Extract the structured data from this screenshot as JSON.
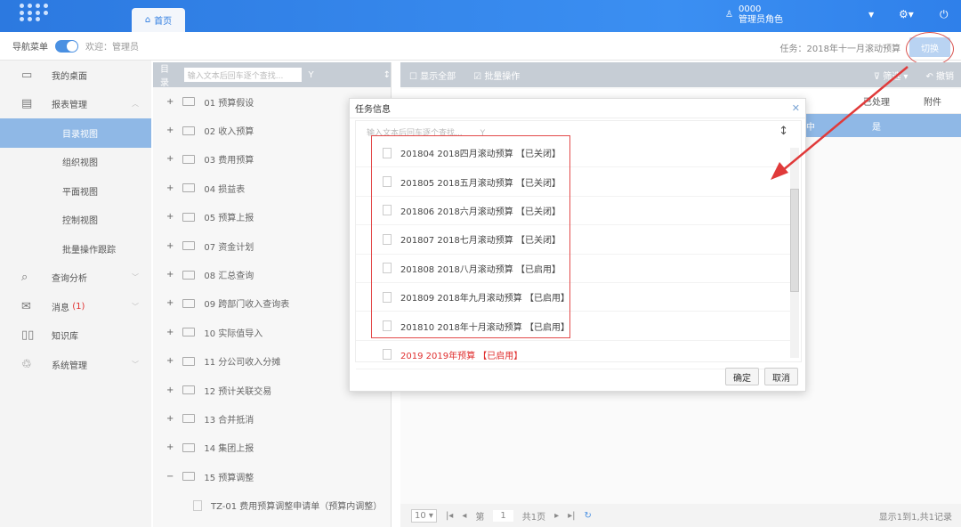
{
  "header": {
    "home_tab": "首页",
    "user_id": "0000",
    "user_role": "管理员角色"
  },
  "subbar": {
    "nav_label": "导航菜单",
    "welcome": "欢迎：管理员",
    "task": "任务：2018年十一月滚动预算",
    "switch": "切换"
  },
  "sidebar": {
    "items": [
      {
        "label": "我的桌面",
        "icon": "monitor-icon"
      },
      {
        "label": "报表管理",
        "icon": "report-icon"
      }
    ],
    "subitems": [
      "目录视图",
      "组织视图",
      "平面视图",
      "控制视图",
      "批量操作跟踪"
    ],
    "bottom": [
      {
        "label": "查询分析"
      },
      {
        "label": "消息",
        "badge": "(1)"
      },
      {
        "label": "知识库"
      },
      {
        "label": "系统管理"
      }
    ]
  },
  "tree": {
    "title": "目录",
    "placeholder": "输入文本后回车逐个查找...",
    "items": [
      "01 预算假设",
      "02 收入预算",
      "03 费用预算",
      "04 损益表",
      "05 预算上报",
      "07 资金计划",
      "08 汇总查询",
      "09 跨部门收入查询表",
      "10 实际值导入",
      "11 分公司收入分摊",
      "12 预计关联交易",
      "13 合并抵消",
      "14 集团上报",
      "15 预算调整"
    ],
    "leaf": "TZ-01 费用预算调整申请单（预算内调整）"
  },
  "main": {
    "show_all": "显示全部",
    "batch": "批量操作",
    "filter": "筛选",
    "undo": "撤销",
    "col_processed": "已处理",
    "col_attach": "附件",
    "row_status": "中",
    "row_processed": "是",
    "pager": {
      "size": "10",
      "page_prefix": "第",
      "page": "1",
      "total_pages": "共1页",
      "summary": "显示1到1,共1记录"
    }
  },
  "modal": {
    "title": "任务信息",
    "placeholder": "输入文本后回车逐个查找...",
    "items": [
      {
        "text": "201804 2018四月滚动预算 【已关闭】",
        "red": false
      },
      {
        "text": "201805 2018五月滚动预算 【已关闭】",
        "red": false
      },
      {
        "text": "201806 2018六月滚动预算 【已关闭】",
        "red": false
      },
      {
        "text": "201807 2018七月滚动预算 【已关闭】",
        "red": false
      },
      {
        "text": "201808 2018八月滚动预算 【已启用】",
        "red": false
      },
      {
        "text": "201809 2018年九月滚动预算 【已启用】",
        "red": false
      },
      {
        "text": "201810 2018年十月滚动预算 【已启用】",
        "red": false
      },
      {
        "text": "2019 2019年预算 【已启用】",
        "red": true
      }
    ],
    "ok": "确定",
    "cancel": "取消"
  }
}
